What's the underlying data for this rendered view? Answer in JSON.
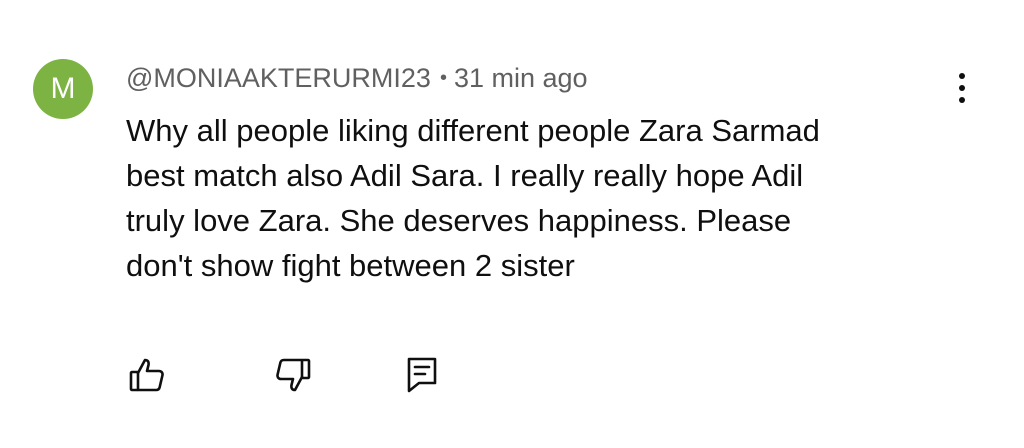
{
  "comment": {
    "avatar_letter": "M",
    "avatar_color": "#7cb342",
    "author": "@MONIAAKTERURMI23",
    "separator": "•",
    "time": "31 min ago",
    "text_lines": [
      "Why all people liking different people Zara Sarmad",
      "best match also Adil Sara. I really really hope Adil",
      "truly love Zara. She deserves happiness. Please",
      "don't show fight between 2 sister"
    ],
    "actions": {
      "like_icon": "thumbs-up-icon",
      "dislike_icon": "thumbs-down-icon",
      "reply_icon": "reply-comment-icon"
    },
    "menu_icon": "more-vertical-icon"
  }
}
